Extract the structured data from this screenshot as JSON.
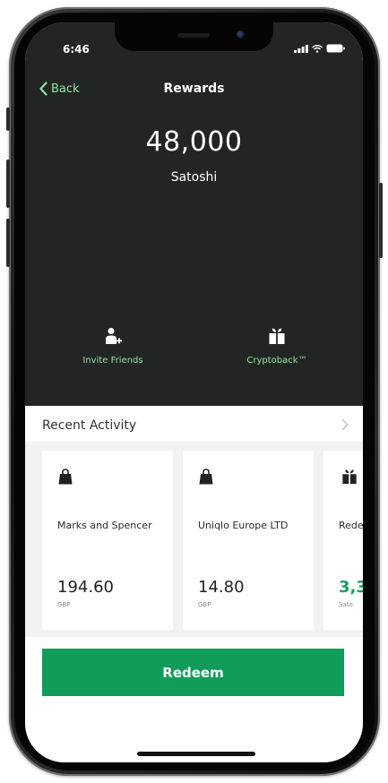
{
  "status_bar": {
    "time": "6:46"
  },
  "nav": {
    "back_label": "Back",
    "title": "Rewards"
  },
  "balance": {
    "amount": "48,000",
    "unit": "Satoshi"
  },
  "actions": [
    {
      "label": "Invite Friends",
      "icon": "add-user-icon"
    },
    {
      "label": "Cryptoback™",
      "icon": "gift-icon"
    }
  ],
  "recent": {
    "title": "Recent Activity",
    "items": [
      {
        "merchant": "Marks and Spencer",
        "value": "194.60",
        "currency": "GBP",
        "icon": "shopping-bag-icon"
      },
      {
        "merchant": "Uniqlo Europe LTD",
        "value": "14.80",
        "currency": "GBP",
        "icon": "shopping-bag-icon"
      },
      {
        "merchant": "Rede",
        "value": "3,3",
        "currency": "Sato",
        "icon": "gift-icon"
      }
    ]
  },
  "redeem_label": "Redeem",
  "colors": {
    "header_bg": "#232524",
    "accent_green": "#8fe3a3",
    "button_green": "#129c59",
    "reward_green": "#16a15c"
  }
}
